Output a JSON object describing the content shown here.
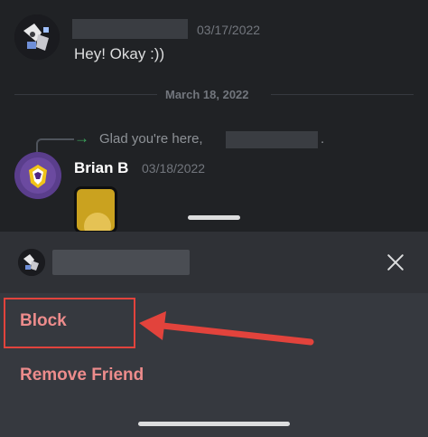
{
  "messages": [
    {
      "timestamp": "03/17/2022",
      "text": "Hey! Okay :))"
    }
  ],
  "date_divider": "March 18, 2022",
  "reply": {
    "text": "Glad you're here,",
    "trailing": "."
  },
  "second_message": {
    "author": "Brian B",
    "timestamp": "03/18/2022"
  },
  "menu": {
    "block_label": "Block",
    "remove_friend_label": "Remove Friend"
  },
  "icons": {
    "close": "close-icon",
    "reply": "reply-arrow-icon"
  },
  "colors": {
    "background": "#202225",
    "sheet": "#36393f",
    "danger_text": "#ed8c8c",
    "annotation_red": "#e2433c"
  }
}
